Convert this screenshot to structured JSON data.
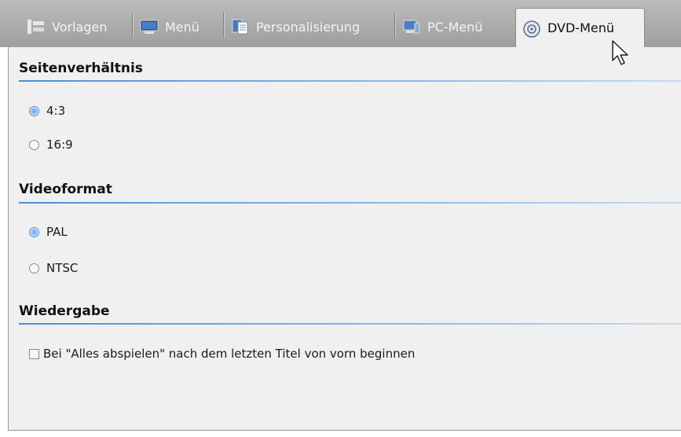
{
  "tabs": [
    {
      "label": "Vorlagen",
      "icon": "templates-icon"
    },
    {
      "label": "Menü",
      "icon": "monitor-icon"
    },
    {
      "label": "Personalisierung",
      "icon": "documents-icon"
    },
    {
      "label": "PC-Menü",
      "icon": "pc-monitor-icon"
    },
    {
      "label": "DVD-Menü",
      "icon": "dvd-icon",
      "active": true
    }
  ],
  "sections": {
    "aspect": {
      "title": "Seitenverhältnis",
      "options": [
        {
          "label": "4:3",
          "selected": true
        },
        {
          "label": "16:9",
          "selected": false
        }
      ]
    },
    "video": {
      "title": "Videoformat",
      "options": [
        {
          "label": "PAL",
          "selected": true
        },
        {
          "label": "NTSC",
          "selected": false
        }
      ]
    },
    "playback": {
      "title": "Wiedergabe",
      "checkbox_label": "Bei \"Alles abspielen\" nach dem letzten Titel von vorn beginnen",
      "checked": false
    }
  },
  "colors": {
    "accent": "#4a8fd8",
    "tabstrip": "#a8a8a8",
    "panel": "#f0f0f0"
  }
}
